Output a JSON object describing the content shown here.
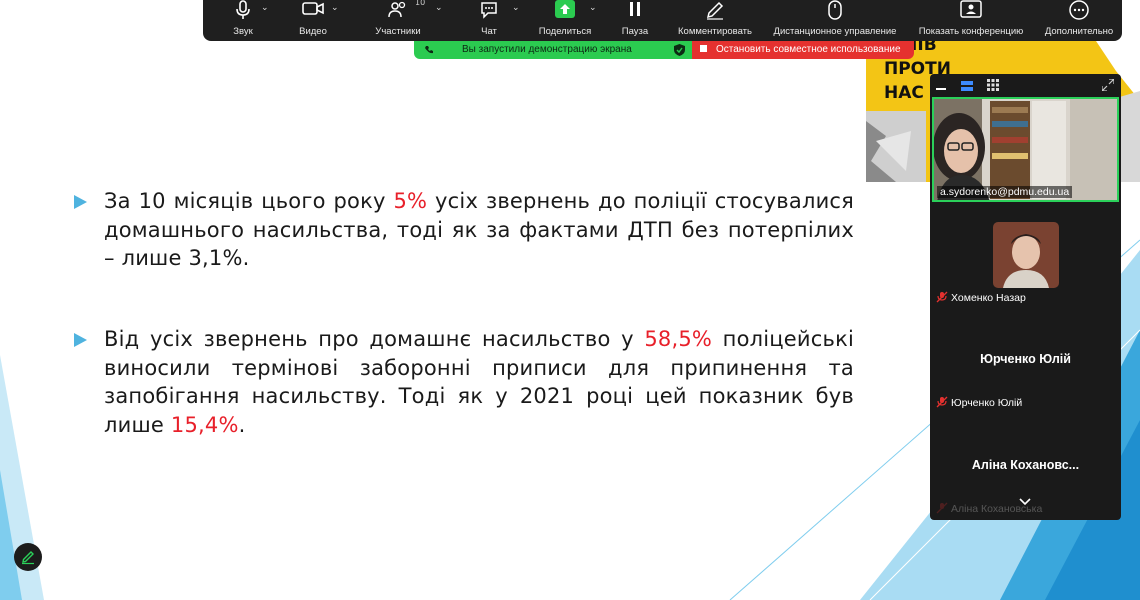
{
  "toolbar": {
    "items": [
      {
        "label": "Звук",
        "icon": "microphone-icon"
      },
      {
        "label": "Видео",
        "icon": "video-camera-icon"
      },
      {
        "label": "Участники",
        "icon": "participants-icon",
        "count": "10"
      },
      {
        "label": "Чат",
        "icon": "chat-icon"
      },
      {
        "label": "Поделиться",
        "icon": "share-screen-icon"
      },
      {
        "label": "Пауза",
        "icon": "pause-icon"
      },
      {
        "label": "Комментировать",
        "icon": "annotate-pen-icon"
      },
      {
        "label": "Дистанционное управление",
        "icon": "remote-control-mouse-icon"
      },
      {
        "label": "Показать конференцию",
        "icon": "show-meeting-icon"
      },
      {
        "label": "Дополнительно",
        "icon": "more-icon"
      }
    ]
  },
  "share_banner": {
    "status": "Вы запустили демонстрацию экрана",
    "stop": "Остановить совместное использование",
    "status_color": "#2bcb50",
    "stop_color": "#e5312f"
  },
  "poster": {
    "line1": "ДНІВ",
    "line2": "ПРОТИ",
    "line3": "НАС"
  },
  "slide": {
    "bullet1": {
      "before": "За 10 місяців цього року ",
      "highlight": "5%",
      "after": " усіх звернень до поліції стосувалися домашнього насильства, тоді як за фактами ДТП без потерпілих – лише 3,1%."
    },
    "bullet2": {
      "before": "Від усіх звернень про домашнє насильство у ",
      "highlight": "58,5%",
      "middle": " поліцейські виносили термінові заборонні приписи для припинення та запобігання насильству. Тоді як у 2021 році цей показник був лише ",
      "highlight2": "15,4%",
      "after": "."
    },
    "accent_color": "#4fb3df",
    "highlight_color": "#e8202a"
  },
  "participants": {
    "active": {
      "name": "a.sydorenko@pdmu.edu.ua"
    },
    "tiles": [
      {
        "name": "Хоменко Назар",
        "muted": true
      },
      {
        "display": "Юрченко Юлій",
        "name": "Юрченко Юлій",
        "muted": true
      },
      {
        "display": "Аліна  Кохановс...",
        "name": "Аліна Кохановська",
        "muted": true
      }
    ]
  }
}
